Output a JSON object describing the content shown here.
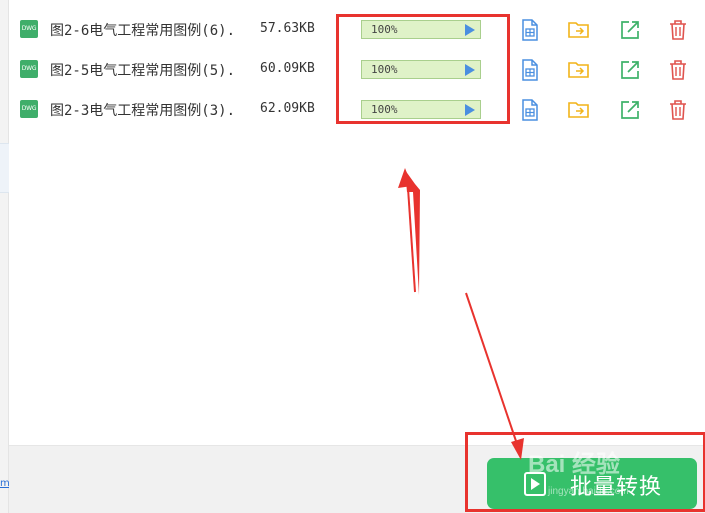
{
  "files": [
    {
      "type_label": "DWG",
      "name": "图2-6电气工程常用图例(6).",
      "size": "57.63KB",
      "progress_percent": 100,
      "progress_label": "100%"
    },
    {
      "type_label": "DWG",
      "name": "图2-5电气工程常用图例(5).",
      "size": "60.09KB",
      "progress_percent": 100,
      "progress_label": "100%"
    },
    {
      "type_label": "DWG",
      "name": "图2-3电气工程常用图例(3).",
      "size": "62.09KB",
      "progress_percent": 100,
      "progress_label": "100%"
    }
  ],
  "actions": {
    "view_icon": "file-preview-icon",
    "folder_icon": "open-folder-icon",
    "open_icon": "external-open-icon",
    "delete_icon": "trash-icon"
  },
  "convert_button": {
    "label": "批量转换"
  },
  "watermark": {
    "text": "Bai 经验",
    "sub": "jingyan.baidu.com"
  },
  "colors": {
    "accent_green": "#36c06a",
    "annotation_red": "#e8332e",
    "progress_bg": "#e6f6d4",
    "view_icon": "#4a8fe0",
    "folder_icon": "#f2b419",
    "open_icon": "#3fb26a",
    "delete_icon": "#e0534e"
  }
}
